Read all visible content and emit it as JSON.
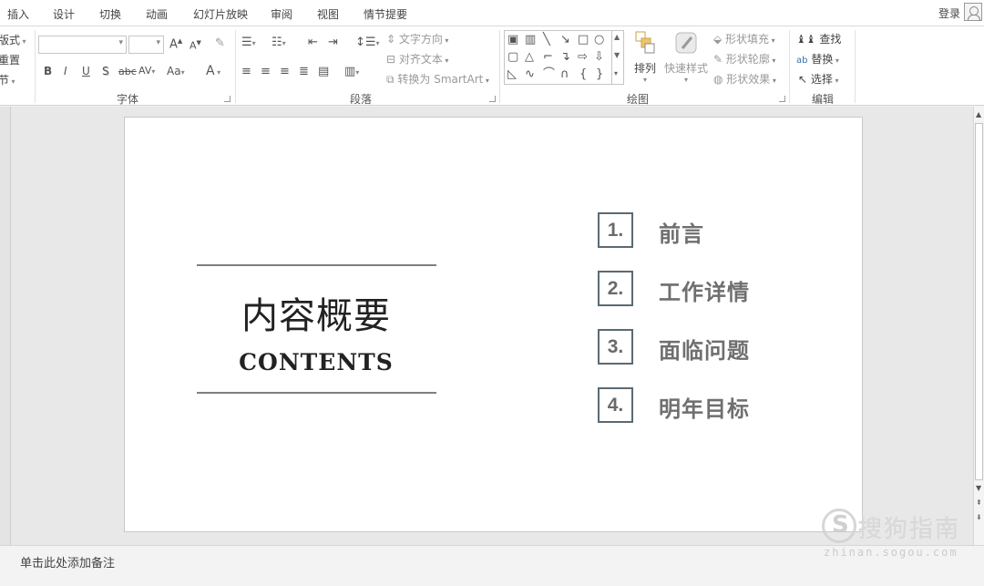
{
  "menu": {
    "tabs": [
      "插入",
      "设计",
      "切换",
      "动画",
      "幻灯片放映",
      "审阅",
      "视图",
      "情节提要"
    ],
    "login": "登录"
  },
  "ribbon": {
    "slides_group": {
      "layout": "版式",
      "reset": "重置",
      "section": "节"
    },
    "font_group": {
      "label": "字体",
      "grow_icon": "A",
      "shrink_icon": "A",
      "bold": "B",
      "italic": "I",
      "underline": "U",
      "shadow": "S",
      "strike": "abc",
      "spacing": "AV",
      "case": "Aa",
      "color": "A"
    },
    "paragraph_group": {
      "label": "段落",
      "text_direction": "文字方向",
      "align_text": "对齐文本",
      "convert_smartart": "转换为 SmartArt"
    },
    "drawing_group": {
      "label": "绘图",
      "arrange": "排列",
      "quick_styles": "快速样式",
      "shape_fill": "形状填充",
      "shape_outline": "形状轮廓",
      "shape_effects": "形状效果"
    },
    "editing_group": {
      "label": "编辑",
      "find": "查找",
      "replace": "替换",
      "select": "选择"
    }
  },
  "slide": {
    "title_cn": "内容概要",
    "title_en": "CONTENTS",
    "toc": [
      {
        "num": "1.",
        "label": "前言"
      },
      {
        "num": "2.",
        "label": "工作详情"
      },
      {
        "num": "3.",
        "label": "面临问题"
      },
      {
        "num": "4.",
        "label": "明年目标"
      }
    ],
    "accent_color": "#5a6a74"
  },
  "notes": {
    "placeholder": "单击此处添加备注"
  },
  "watermark": {
    "brand": "搜狗指南",
    "url": "zhinan.sogou.com"
  }
}
